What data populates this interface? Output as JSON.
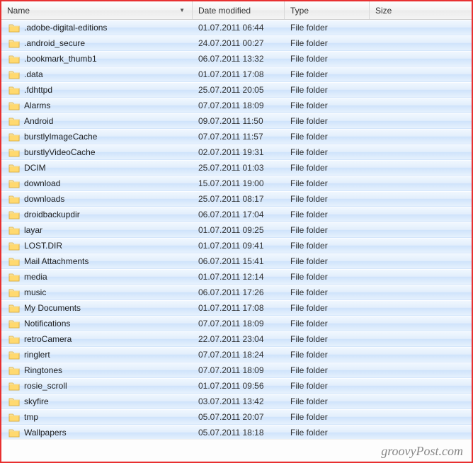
{
  "columns": {
    "name": "Name",
    "date": "Date modified",
    "type": "Type",
    "size": "Size"
  },
  "sort_indicator": "▼",
  "icon_name": "folder-icon",
  "rows": [
    {
      "name": ".adobe-digital-editions",
      "date": "01.07.2011 06:44",
      "type": "File folder",
      "size": ""
    },
    {
      "name": ".android_secure",
      "date": "24.07.2011 00:27",
      "type": "File folder",
      "size": ""
    },
    {
      "name": ".bookmark_thumb1",
      "date": "06.07.2011 13:32",
      "type": "File folder",
      "size": ""
    },
    {
      "name": ".data",
      "date": "01.07.2011 17:08",
      "type": "File folder",
      "size": ""
    },
    {
      "name": ".fdhttpd",
      "date": "25.07.2011 20:05",
      "type": "File folder",
      "size": ""
    },
    {
      "name": "Alarms",
      "date": "07.07.2011 18:09",
      "type": "File folder",
      "size": ""
    },
    {
      "name": "Android",
      "date": "09.07.2011 11:50",
      "type": "File folder",
      "size": ""
    },
    {
      "name": "burstlyImageCache",
      "date": "07.07.2011 11:57",
      "type": "File folder",
      "size": ""
    },
    {
      "name": "burstlyVideoCache",
      "date": "02.07.2011 19:31",
      "type": "File folder",
      "size": ""
    },
    {
      "name": "DCIM",
      "date": "25.07.2011 01:03",
      "type": "File folder",
      "size": ""
    },
    {
      "name": "download",
      "date": "15.07.2011 19:00",
      "type": "File folder",
      "size": ""
    },
    {
      "name": "downloads",
      "date": "25.07.2011 08:17",
      "type": "File folder",
      "size": ""
    },
    {
      "name": "droidbackupdir",
      "date": "06.07.2011 17:04",
      "type": "File folder",
      "size": ""
    },
    {
      "name": "layar",
      "date": "01.07.2011 09:25",
      "type": "File folder",
      "size": ""
    },
    {
      "name": "LOST.DIR",
      "date": "01.07.2011 09:41",
      "type": "File folder",
      "size": ""
    },
    {
      "name": "Mail Attachments",
      "date": "06.07.2011 15:41",
      "type": "File folder",
      "size": ""
    },
    {
      "name": "media",
      "date": "01.07.2011 12:14",
      "type": "File folder",
      "size": ""
    },
    {
      "name": "music",
      "date": "06.07.2011 17:26",
      "type": "File folder",
      "size": ""
    },
    {
      "name": "My Documents",
      "date": "01.07.2011 17:08",
      "type": "File folder",
      "size": ""
    },
    {
      "name": "Notifications",
      "date": "07.07.2011 18:09",
      "type": "File folder",
      "size": ""
    },
    {
      "name": "retroCamera",
      "date": "22.07.2011 23:04",
      "type": "File folder",
      "size": ""
    },
    {
      "name": "ringlert",
      "date": "07.07.2011 18:24",
      "type": "File folder",
      "size": ""
    },
    {
      "name": "Ringtones",
      "date": "07.07.2011 18:09",
      "type": "File folder",
      "size": ""
    },
    {
      "name": "rosie_scroll",
      "date": "01.07.2011 09:56",
      "type": "File folder",
      "size": ""
    },
    {
      "name": "skyfire",
      "date": "03.07.2011 13:42",
      "type": "File folder",
      "size": ""
    },
    {
      "name": "tmp",
      "date": "05.07.2011 20:07",
      "type": "File folder",
      "size": ""
    },
    {
      "name": "Wallpapers",
      "date": "05.07.2011 18:18",
      "type": "File folder",
      "size": ""
    }
  ],
  "footer": "groovyPost.com"
}
